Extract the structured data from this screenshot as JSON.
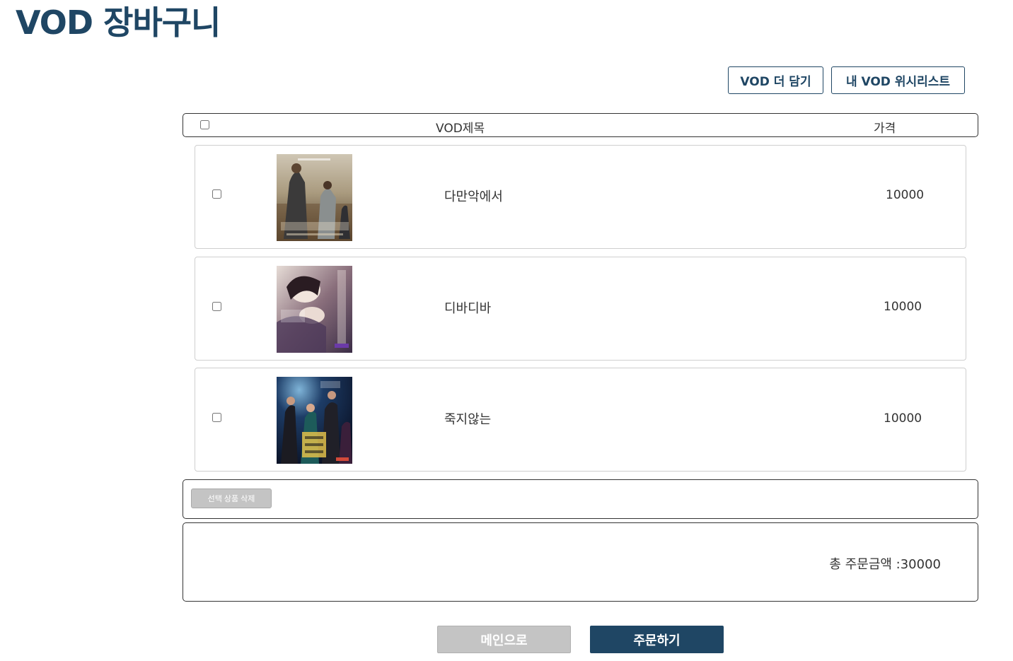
{
  "page": {
    "title": "VOD 장바구니"
  },
  "toolbar": {
    "more_vod_label": "VOD 더 담기",
    "wishlist_label": "내 VOD 위시리스트"
  },
  "table": {
    "header_title": "VOD제목",
    "header_price": "가격"
  },
  "items": [
    {
      "title": "다만악에서",
      "price": "10000",
      "poster": "poster-dark-suits-desert"
    },
    {
      "title": "디바디바",
      "price": "10000",
      "poster": "poster-diva-water"
    },
    {
      "title": "죽지않는",
      "price": "10000",
      "poster": "poster-dark-night-group"
    }
  ],
  "actions": {
    "delete_selected_label": "선택 상품 삭제"
  },
  "summary": {
    "total_label": "총 주문금액 :30000"
  },
  "footer": {
    "main_label": "메인으로",
    "order_label": "주문하기"
  },
  "colors": {
    "brand": "#1f4664",
    "disabled": "#c4c4c4"
  }
}
